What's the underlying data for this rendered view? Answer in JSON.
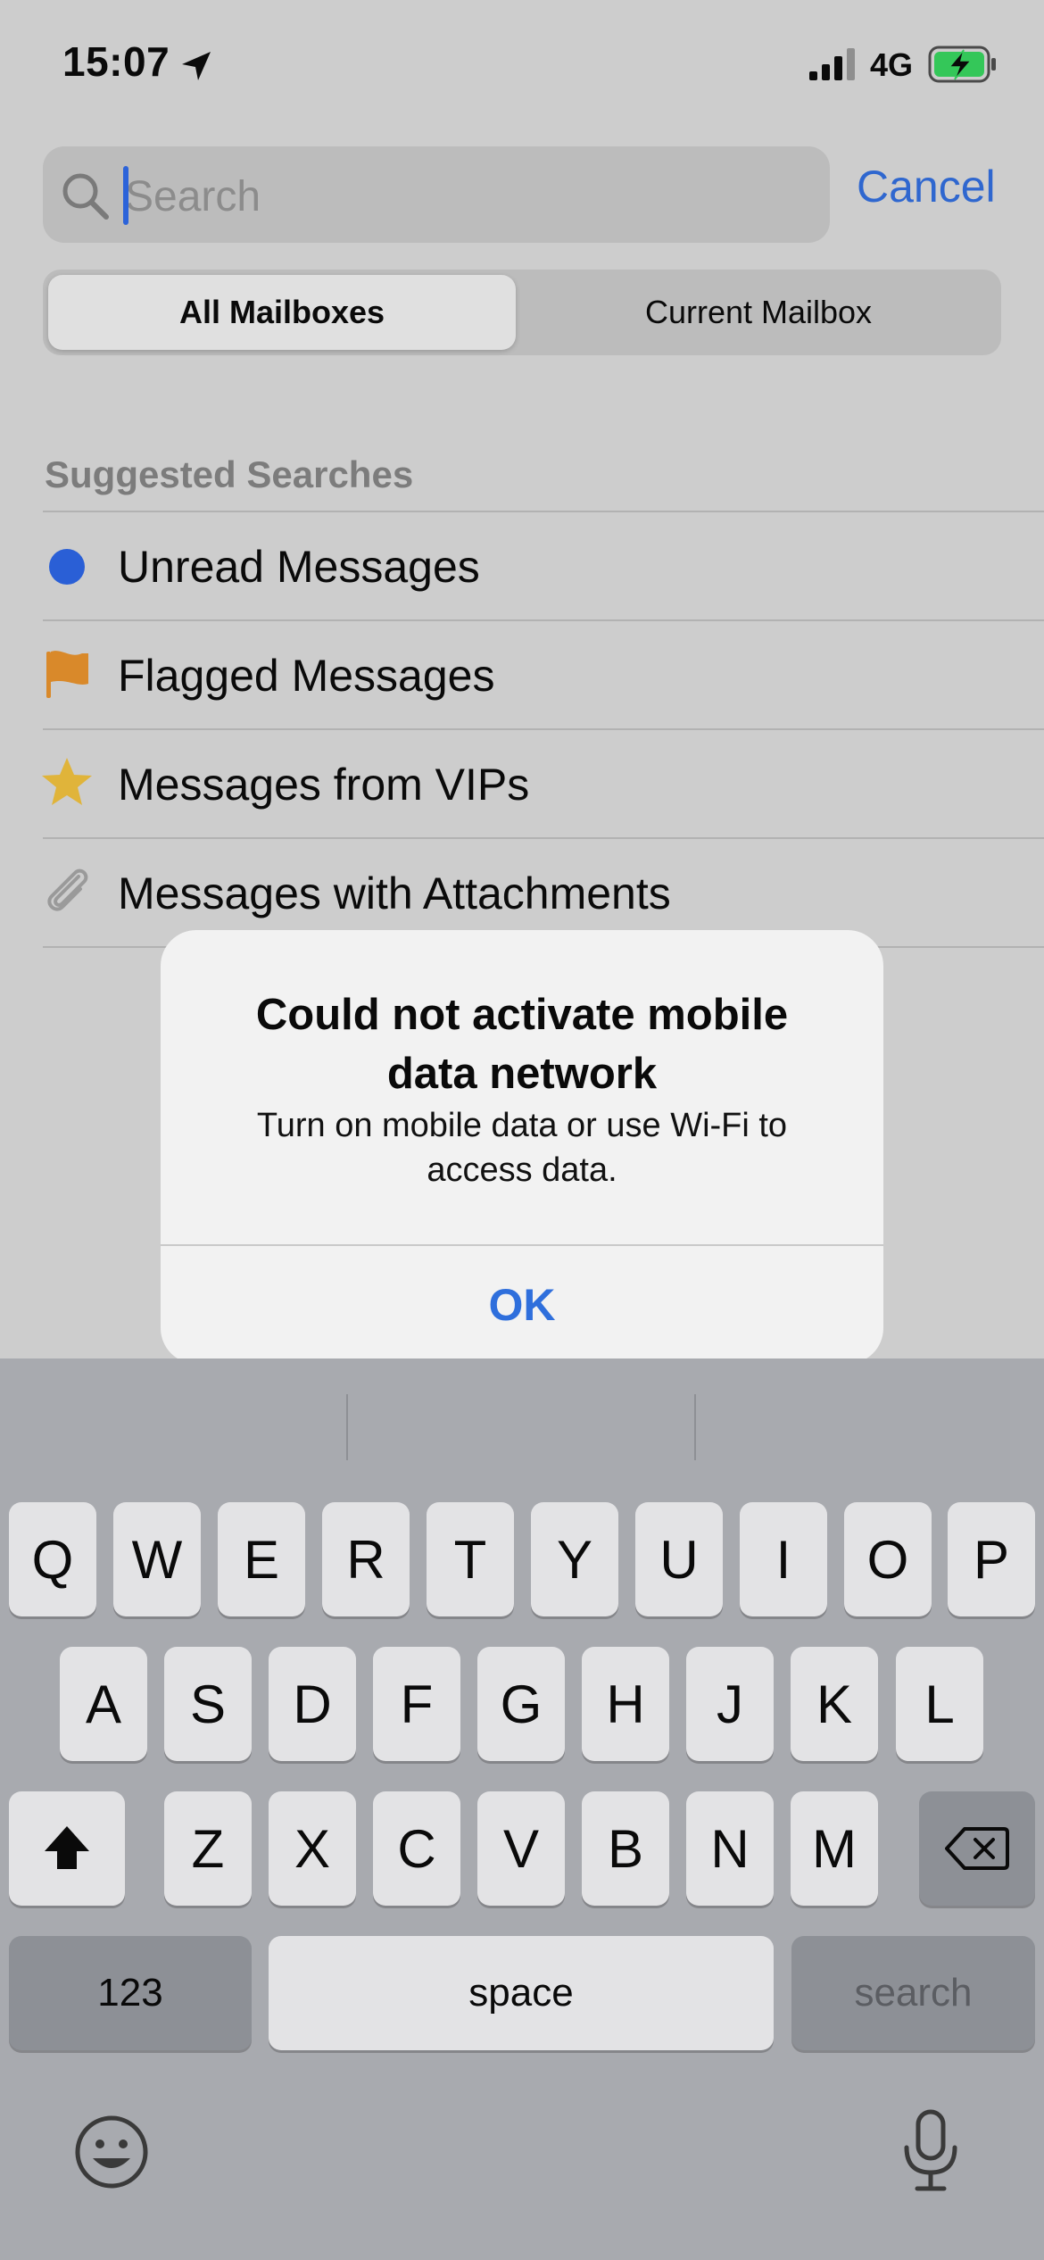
{
  "status_bar": {
    "time": "15:07",
    "network": "4G",
    "location_icon": "location-arrow-icon",
    "signal_icon": "signal-bars-icon",
    "battery_icon": "battery-charging-icon",
    "battery_color": "#34c759"
  },
  "search": {
    "placeholder": "Search",
    "value": "",
    "cancel_label": "Cancel"
  },
  "scope": {
    "options": [
      "All Mailboxes",
      "Current Mailbox"
    ],
    "selected": "All Mailboxes"
  },
  "suggestions": {
    "header": "Suggested Searches",
    "items": [
      {
        "label": "Unread Messages",
        "icon": "unread-dot-icon",
        "color": "#2a5fd6"
      },
      {
        "label": "Flagged Messages",
        "icon": "flag-icon",
        "color": "#d9892a"
      },
      {
        "label": "Messages from VIPs",
        "icon": "star-icon",
        "color": "#e0b43a"
      },
      {
        "label": "Messages with Attachments",
        "icon": "paperclip-icon",
        "color": "#9a9a9a"
      }
    ]
  },
  "alert": {
    "title": "Could not activate mobile data network",
    "message": "Turn on mobile data or use Wi-Fi to access data.",
    "ok_label": "OK"
  },
  "keyboard": {
    "row1": [
      "Q",
      "W",
      "E",
      "R",
      "T",
      "Y",
      "U",
      "I",
      "O",
      "P"
    ],
    "row2": [
      "A",
      "S",
      "D",
      "F",
      "G",
      "H",
      "J",
      "K",
      "L"
    ],
    "row3": [
      "Z",
      "X",
      "C",
      "V",
      "B",
      "N",
      "M"
    ],
    "numbers_label": "123",
    "space_label": "space",
    "search_label": "search"
  },
  "colors": {
    "accent": "#2f67cf",
    "background": "#cdcdcd",
    "keyboard": "#a8aaaf"
  }
}
